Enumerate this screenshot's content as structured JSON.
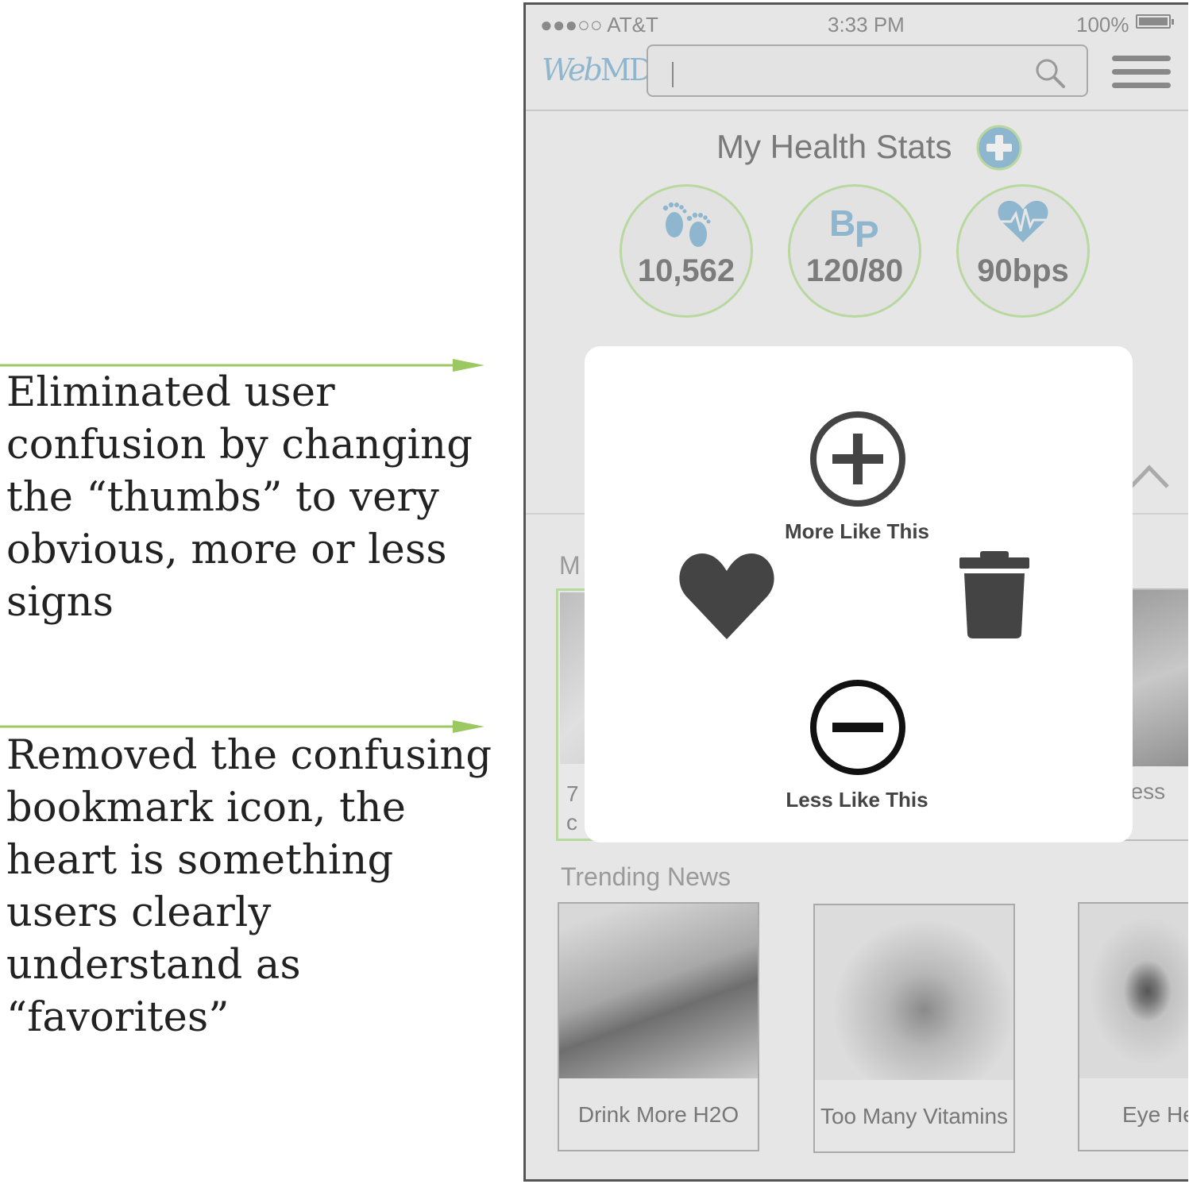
{
  "annotations": [
    {
      "text": "Eliminated user confusion by changing the “thumbs” to very obvious, more or less signs"
    },
    {
      "text": "Removed the confusing bookmark icon, the heart is something users clearly understand as “favorites”"
    }
  ],
  "colors": {
    "accent_green": "#9bc860",
    "webmd_blue": "#8fb6cf",
    "stat_ring": "#b8d8a0"
  },
  "status_bar": {
    "carrier": "●●●○○ AT&T",
    "time": "3:33 PM",
    "battery": "100%"
  },
  "header": {
    "logo_web": "Web",
    "logo_md": "MD",
    "search_value": "",
    "icons": [
      "search-icon",
      "menu-icon"
    ]
  },
  "health_stats": {
    "title": "My Health Stats",
    "items": [
      {
        "icon": "footprints-icon",
        "value": "10,562"
      },
      {
        "icon": "bp-icon",
        "value": "120/80"
      },
      {
        "icon": "heartbeat-icon",
        "value": "90bps"
      }
    ]
  },
  "my_section": {
    "title_visible": "M",
    "left_card_label": "7\nc",
    "right_card_label": "itness"
  },
  "modal": {
    "more_label": "More Like This",
    "less_label": "Less Like This",
    "icons": [
      "plus-circle-icon",
      "heart-icon",
      "trash-icon",
      "minus-circle-icon"
    ]
  },
  "trending": {
    "title": "Trending News",
    "cards": [
      {
        "label": "Drink More H2O"
      },
      {
        "label": "Too Many Vitamins"
      },
      {
        "label": "Eye He"
      }
    ]
  }
}
